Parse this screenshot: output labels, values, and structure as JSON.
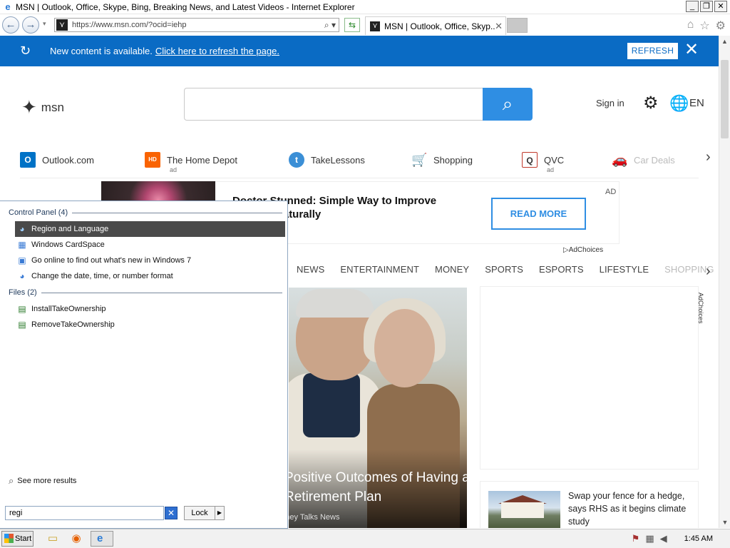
{
  "window": {
    "title": "MSN | Outlook, Office, Skype, Bing, Breaking News, and Latest Videos - Internet Explorer",
    "controls": {
      "minimize": "_",
      "restore": "❐",
      "close": "✕"
    }
  },
  "navbar": {
    "back_glyph": "←",
    "forward_glyph": "→",
    "url": "https://www.msn.com/?ocid=iehp",
    "address_icons": "⌕ ▾",
    "tab_title": "MSN | Outlook, Office, Skyp...",
    "tab_close": "✕",
    "toolbar_icons": {
      "home": "⌂",
      "favorites": "☆",
      "tools": "⚙"
    }
  },
  "notification": {
    "message": "New content is available.",
    "link": "Click here to refresh the page.",
    "button": "REFRESH",
    "close": "✕"
  },
  "header": {
    "logo_text": "msn",
    "sign_in": "Sign in",
    "language": "EN"
  },
  "quicklinks": [
    {
      "label": "Outlook.com",
      "ad": "",
      "icon": "outlook-icon",
      "color": "#0072c6",
      "glyph": "O"
    },
    {
      "label": "The Home Depot",
      "ad": "ad",
      "icon": "home-depot-icon",
      "color": "#f96302",
      "glyph": "HD"
    },
    {
      "label": "TakeLessons",
      "ad": "",
      "icon": "takelessons-icon",
      "color": "#3b8fd6",
      "glyph": "t"
    },
    {
      "label": "Shopping",
      "ad": "",
      "icon": "shopping-cart-icon",
      "color": "#1f6fd1",
      "glyph": "🛒"
    },
    {
      "label": "QVC",
      "ad": "ad",
      "icon": "qvc-icon",
      "color": "#c0392b",
      "glyph": "Q"
    },
    {
      "label": "Car Deals",
      "ad": "",
      "icon": "car-icon",
      "color": "#2a6cb8",
      "glyph": "🚗"
    }
  ],
  "ad": {
    "title": "Doctor Stunned: Simple Way to Improve Hearing Naturally",
    "button": "READ MORE",
    "label": "AD",
    "adchoices": "AdChoices"
  },
  "categories": [
    "NEWS",
    "ENTERTAINMENT",
    "MONEY",
    "SPORTS",
    "ESPORTS",
    "LIFESTYLE",
    "SHOPPING"
  ],
  "hero": {
    "title": "Positive Outcomes of Having a Retirement Plan",
    "source": "Money Talks News"
  },
  "side_ad": {
    "adchoices": "AdChoices"
  },
  "story": {
    "text": "Swap your fence for a hedge, says RHS as it begins climate study"
  },
  "start_menu": {
    "group1_label": "Control Panel (4)",
    "group1_items": [
      {
        "label": "Region and Language",
        "selected": true,
        "icon": "region-language-icon",
        "glyph": "🌐"
      },
      {
        "label": "Windows CardSpace",
        "selected": false,
        "icon": "cardspace-icon",
        "glyph": "▦"
      },
      {
        "label": "Go online to find out what's new in Windows 7",
        "selected": false,
        "icon": "windows-info-icon",
        "glyph": "▣"
      },
      {
        "label": "Change the date, time, or number format",
        "selected": false,
        "icon": "globe-clock-icon",
        "glyph": "🌐"
      }
    ],
    "group2_label": "Files (2)",
    "group2_items": [
      {
        "label": "InstallTakeOwnership",
        "icon": "registry-file-icon",
        "glyph": "▤"
      },
      {
        "label": "RemoveTakeOwnership",
        "icon": "registry-file-icon",
        "glyph": "▤"
      }
    ],
    "see_more": "See more results",
    "search_value": "regi",
    "clear_glyph": "✕",
    "lock_label": "Lock",
    "lock_arrow": "▶"
  },
  "taskbar": {
    "start_label": "Start",
    "clock": "1:45 AM"
  },
  "colors": {
    "notification_bg": "#0a6bc4",
    "search_button": "#2f8ee3",
    "start_menu_selection": "#4a4a4a"
  }
}
